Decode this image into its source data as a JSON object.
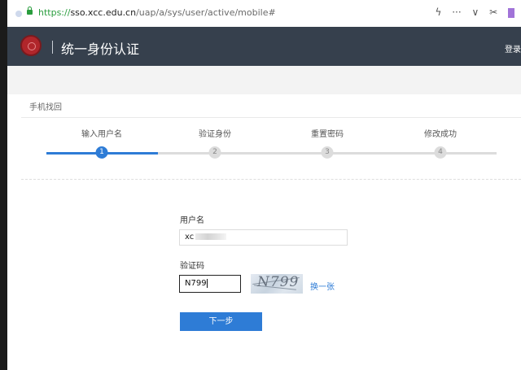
{
  "browser": {
    "url_protocol": "https://",
    "url_host": "sso.xcc.edu.cn",
    "url_path": "/uap/a/sys/user/active/mobile#",
    "toolbar_more": "···",
    "toolbar_chevron": "∨",
    "toolbar_bolt": "ϟ",
    "toolbar_scissors": "✂"
  },
  "header": {
    "title": "统一身份认证",
    "login_label": "登录"
  },
  "panel": {
    "title": "手机找回"
  },
  "steps": [
    {
      "label": "输入用户名",
      "number": "1",
      "active": true
    },
    {
      "label": "验证身份",
      "number": "2",
      "active": false
    },
    {
      "label": "重置密码",
      "number": "3",
      "active": false
    },
    {
      "label": "修改成功",
      "number": "4",
      "active": false
    }
  ],
  "progress": {
    "completed_fraction": 0.25
  },
  "form": {
    "username_label": "用户名",
    "username_value": "xc",
    "captcha_label": "验证码",
    "captcha_value": "N799",
    "captcha_image_text": "N799",
    "refresh_label": "换一张",
    "next_label": "下一步"
  },
  "colors": {
    "accent": "#2e7cd6",
    "header_bg": "#36404d"
  }
}
